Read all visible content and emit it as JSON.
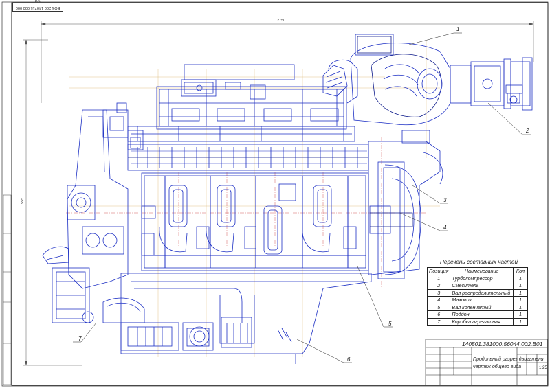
{
  "stamp": "БОБ 200 140715 000 000 В01",
  "dimensions": {
    "width": "2750",
    "height": "1555"
  },
  "callouts": [
    "1",
    "2",
    "3",
    "4",
    "5",
    "6",
    "7"
  ],
  "parts_table": {
    "title": "Перечень составных частей",
    "headers": [
      "Позиция",
      "Наименование",
      "Кол"
    ],
    "rows": [
      [
        "1",
        "Турбокомпрессор",
        "1"
      ],
      [
        "2",
        "Смеситель",
        "1"
      ],
      [
        "3",
        "Вал распределительный",
        "1"
      ],
      [
        "4",
        "Маховик",
        "1"
      ],
      [
        "5",
        "Вал коленчатый",
        "1"
      ],
      [
        "6",
        "Поддон",
        "1"
      ],
      [
        "7",
        "Коробка агрегатная",
        "1"
      ]
    ]
  },
  "title_block": {
    "code": "140501.381000.56044.002.В01",
    "name_line1": "Продольный разрез двигателя",
    "name_line2": "чертеж общего вида",
    "scale": "1:25"
  },
  "colors": {
    "line": "#1c2fc4",
    "line_dark": "#0d1a8a",
    "center": "#c83232",
    "aux": "#d4a95a",
    "frame": "#222222"
  }
}
